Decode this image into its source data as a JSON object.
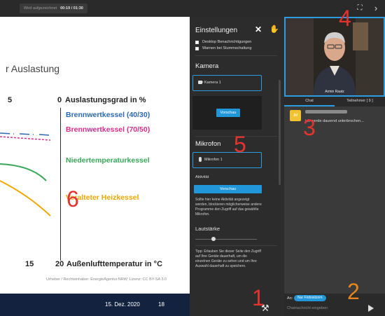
{
  "topbar": {
    "recording_label": "Wird aufgezeichnet",
    "recording_time": "00:19 / 01:30",
    "expand_icon": "expand-icon",
    "next_icon": "chevron-right-icon"
  },
  "slide": {
    "title": "r Auslastung",
    "axis_y_top": "0",
    "axis_y_label": "Auslastungsgrad in %",
    "tick_left_top": "5",
    "tick_15": "15",
    "tick_20": "20",
    "axis_x_label": "Außenlufttemperatur in °C",
    "series": [
      {
        "label": "Brennwertkessel (40/30)",
        "color": "#2d68b0"
      },
      {
        "label": "Brennwertkessel (70/50)",
        "color": "#d62d8c"
      },
      {
        "label": "Niedertemperaturkessel",
        "color": "#3aa85a"
      },
      {
        "label": "Veralteter Heizkessel",
        "color": "#f0a800"
      }
    ],
    "credit": "Urheber / Rechteinhaber: EnergieAgentur.NRW; Lizenz: CC BY-SA 3.0",
    "footer_date": "15. Dez. 2020",
    "footer_page": "18"
  },
  "markers": {
    "m1": "1",
    "m2": "2",
    "m3": "3",
    "m4": "4",
    "m5": "5",
    "m6": "6"
  },
  "settings": {
    "title": "Einstellungen",
    "close_icon": "close-icon",
    "hand_icon": "hand-icon",
    "checkboxes": [
      {
        "label": "Desktop Benachrichtigungen",
        "checked": false
      },
      {
        "label": "Warnen bei Stummschaltung",
        "checked": false
      }
    ],
    "kamera_title": "Kamera",
    "kamera_value": "Kamera 1",
    "vorschau_cam": "Vorschau",
    "mikrofon_title": "Mikrofon",
    "mikrofon_value": "Mikrofon 1",
    "aktivitaet_title": "Aktivität",
    "vorschau_mic": "Vorschau",
    "mic_hint": "Sollte hier keine Aktivität angezeigt werden, blockieren möglicherweise andere Programme den Zugriff auf das gewählte Mikrofon.",
    "lautstaerke_title": "Lautstärke",
    "volume_level": 0.3,
    "tip": "Tipp: Erlauben Sie dieser Seite den Zugriff auf Ihre Geräte dauerhaft, um die einzelnen Geräte zu sehen und um Ihre Auswahl dauerhaft zu speichern.",
    "tools_icon": "tools-icon"
  },
  "right": {
    "video_name": "Armin Raatz",
    "tab_chat": "Chat",
    "tab_participants": "Teilnehmer [ 9 ]",
    "message": {
      "avatar": "JM",
      "text": "ich werde dauernd unterbrochen..."
    },
    "to_label": "An:",
    "recipient": "Nur Firdositzorn",
    "input_placeholder": "Chatnachricht eingeben",
    "send_icon": "send-icon"
  },
  "colors": {
    "accent": "#2e9de0",
    "button": "#2196d9",
    "marker_red": "#e4332f",
    "marker_orange": "#e4841e"
  }
}
